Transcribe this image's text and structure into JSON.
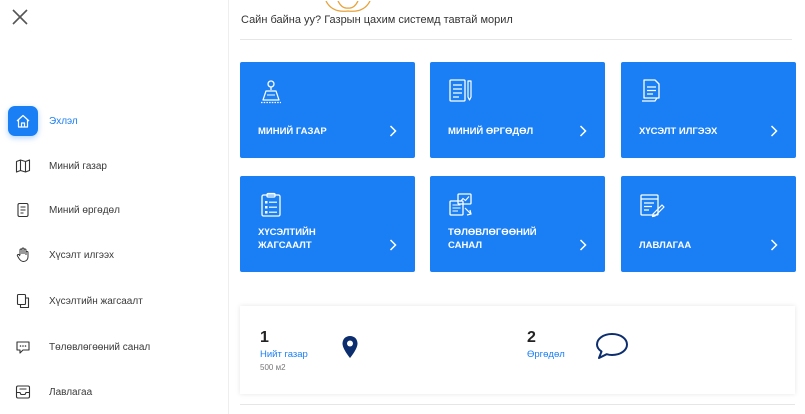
{
  "sidebar": {
    "items": [
      {
        "label": "Эхлэл",
        "icon": "home-icon",
        "active": true
      },
      {
        "label": "Миний газар",
        "icon": "map-icon"
      },
      {
        "label": "Миний өргөдөл",
        "icon": "document-icon"
      },
      {
        "label": "Хүсэлт илгээх",
        "icon": "hand-pointer-icon"
      },
      {
        "label": "Хүсэлтийн жагсаалт",
        "icon": "copy-icon"
      },
      {
        "label": "Төлөвлөгөөний санал",
        "icon": "chat-icon"
      },
      {
        "label": "Лавлагаа",
        "icon": "inbox-icon"
      }
    ]
  },
  "header": {
    "greeting": "Сайн байна уу? Газрын цахим системд тавтай морил"
  },
  "cards": [
    {
      "title": "МИНИЙ ГАЗАР",
      "icon": "land-map-pin-icon"
    },
    {
      "title": "МИНИЙ ӨРГӨДӨЛ",
      "icon": "document-pen-icon"
    },
    {
      "title": "ХҮСЭЛТ ИЛГЭЭХ",
      "icon": "document-send-icon"
    },
    {
      "title": "ХҮСЭЛТИЙН ЖАГСААЛТ",
      "icon": "clipboard-list-icon"
    },
    {
      "title": "ТӨЛӨВЛӨГӨӨНИЙ САНАЛ",
      "icon": "plan-chart-icon"
    },
    {
      "title": "ЛАВЛАГАА",
      "icon": "document-sign-icon"
    }
  ],
  "stats": [
    {
      "number": "1",
      "label": "Нийт газар",
      "sub": "500 м2",
      "icon": "map-pin-icon"
    },
    {
      "number": "2",
      "label": "Өргөдөл",
      "sub": "",
      "icon": "speech-bubble-icon"
    }
  ],
  "colors": {
    "accent": "#1a7ff5",
    "pin": "#0d2e6e"
  }
}
